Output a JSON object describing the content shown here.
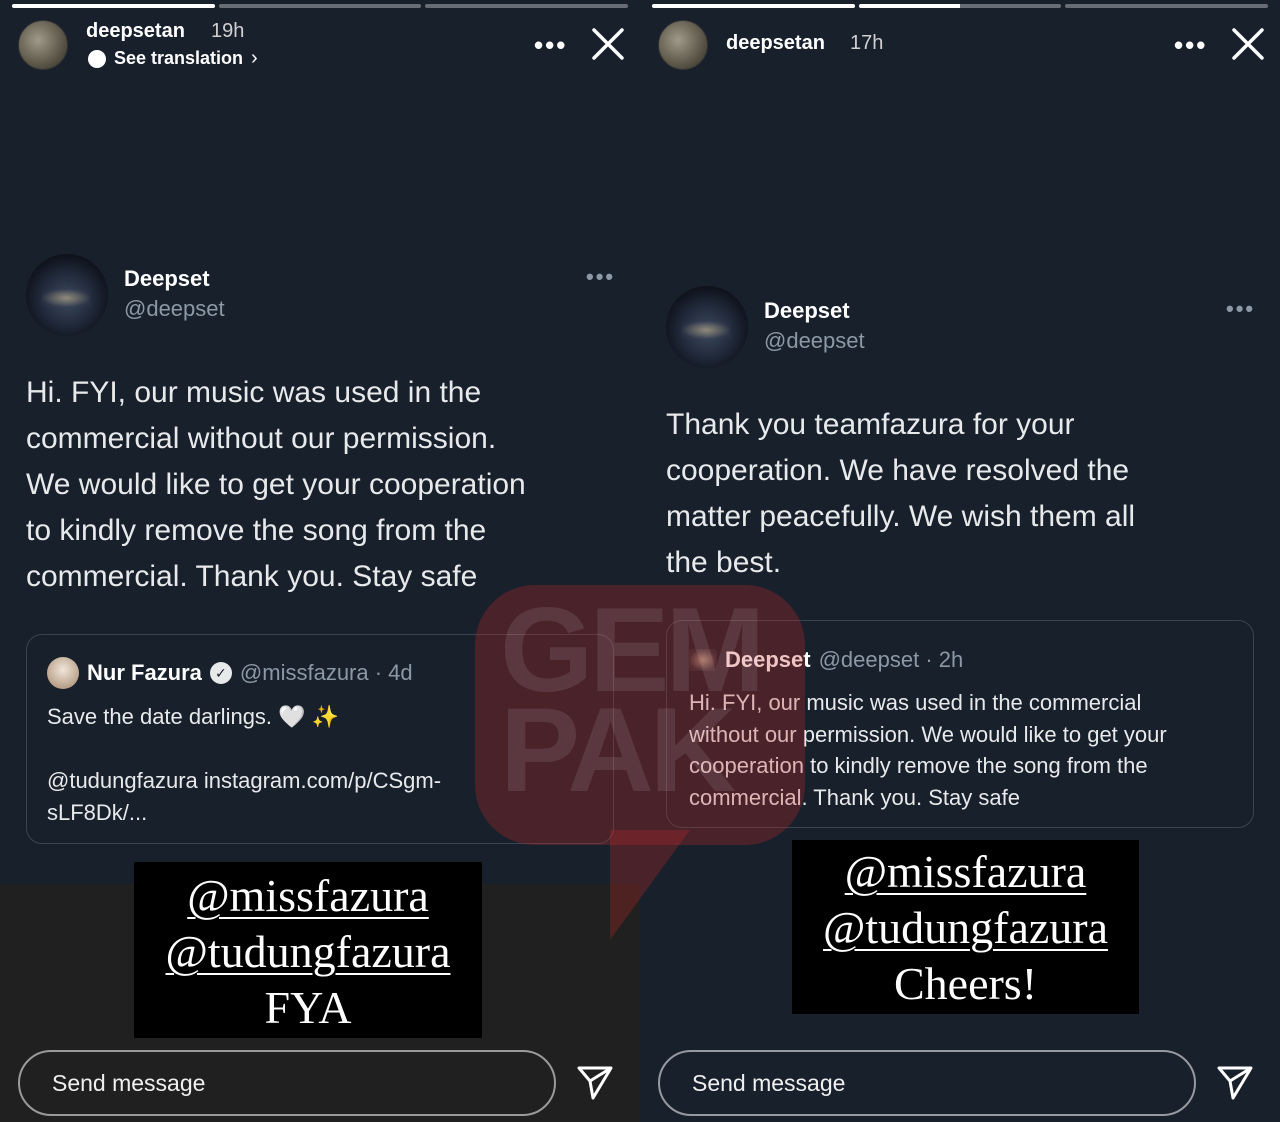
{
  "left_story": {
    "progress": [
      1.0,
      0.0,
      0.0
    ],
    "username": "deepsetan",
    "time": "19h",
    "translation_label": "See translation",
    "tweet": {
      "name": "Deepset",
      "handle": "@deepset",
      "body_lines": [
        "Hi. FYI, our music was used in the",
        "commercial without our permission.",
        "We would like to get your cooperation",
        "to kindly remove the song from the",
        "commercial. Thank you. Stay safe"
      ],
      "quote": {
        "name": "Nur Fazura",
        "meta": "@missfazura · 4d",
        "text_line1": "Save the date darlings.",
        "emoji": "🤍 ✨",
        "link_line1": "@tudungfazura instagram.com/p/CSgm-",
        "link_line2": "sLF8Dk/..."
      }
    },
    "label_lines": [
      "@missfazura",
      "@tudungfazura",
      "FYA"
    ],
    "send_placeholder": "Send message"
  },
  "right_story": {
    "progress": [
      1.0,
      0.5,
      0.0
    ],
    "username": "deepsetan",
    "time": "17h",
    "tweet": {
      "name": "Deepset",
      "handle": "@deepset",
      "body_lines": [
        "Thank you teamfazura for your",
        "cooperation. We have resolved the",
        "matter peacefully. We wish them all",
        "the best."
      ],
      "quote": {
        "name": "Deepset",
        "meta": "@deepset · 2h",
        "text_lines": [
          "Hi. FYI, our music was used in the commercial",
          "without our permission. We would like to get your",
          "cooperation to kindly remove the song from the",
          "commercial. Thank you. Stay safe"
        ]
      }
    },
    "label_lines": [
      "@missfazura",
      "@tudungfazura",
      "Cheers!"
    ],
    "send_placeholder": "Send message"
  },
  "watermark": "GEM PAK",
  "icons": {
    "more": "more-icon",
    "close": "close-icon",
    "send": "send-icon",
    "verified": "verified-icon"
  },
  "colors": {
    "background": "#18202c",
    "muted_text": "#8b98a5",
    "watermark": "#c82828"
  }
}
